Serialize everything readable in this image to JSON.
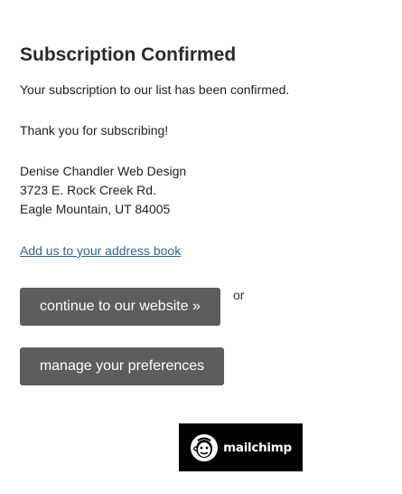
{
  "page": {
    "title": "Subscription Confirmed",
    "message": "Your subscription to our list has been confirmed.",
    "thanks": "Thank you for subscribing!",
    "address": {
      "name": "Denise Chandler Web Design",
      "street": "3723 E. Rock Creek Rd.",
      "city_line": "Eagle Mountain, UT 84005"
    },
    "address_book_link": "Add us to your address book"
  },
  "actions": {
    "continue_label": "continue to our website »",
    "or_text": "or",
    "manage_label": "manage your preferences"
  },
  "badge": {
    "label": "mailchimp",
    "icon": "mailchimp-freddie-icon"
  },
  "colors": {
    "button_bg": "#5d5d5d",
    "link": "#336699",
    "badge_bg": "#000000"
  }
}
